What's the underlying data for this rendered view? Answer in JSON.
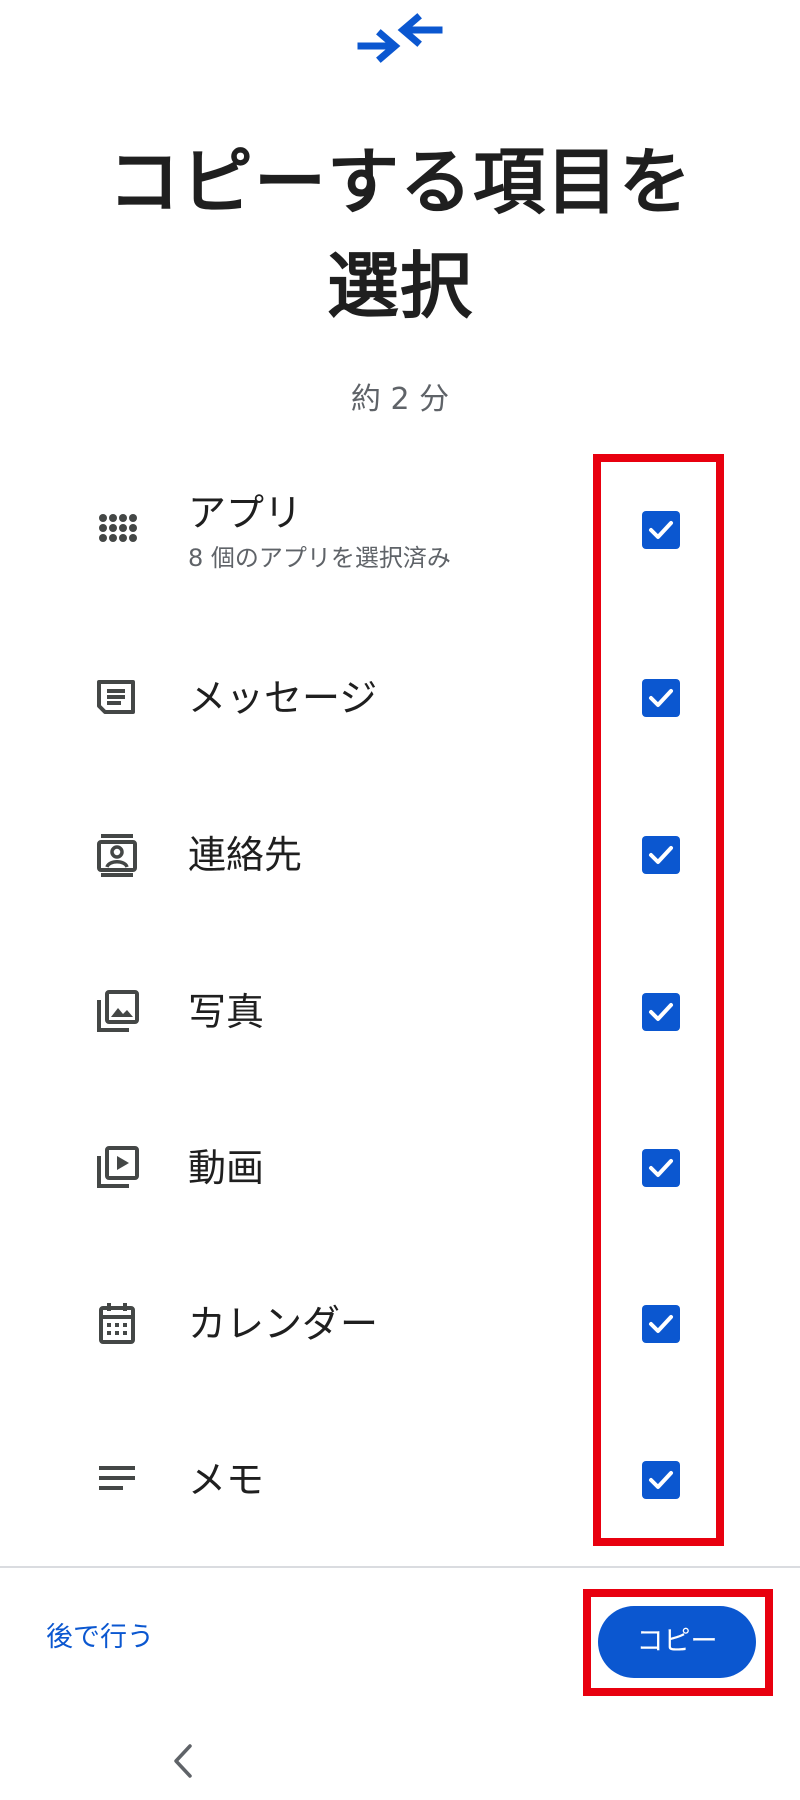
{
  "header": {
    "title_line1": "コピーする項目を",
    "title_line2": "選択",
    "subtitle": "約 2 分"
  },
  "items": [
    {
      "label": "アプリ",
      "sublabel": "8 個のアプリを選択済み",
      "icon": "apps-grid-icon",
      "checked": true
    },
    {
      "label": "メッセージ",
      "icon": "message-icon",
      "checked": true
    },
    {
      "label": "連絡先",
      "icon": "contacts-icon",
      "checked": true
    },
    {
      "label": "写真",
      "icon": "photos-icon",
      "checked": true
    },
    {
      "label": "動画",
      "icon": "video-icon",
      "checked": true
    },
    {
      "label": "カレンダー",
      "icon": "calendar-icon",
      "checked": true
    },
    {
      "label": "メモ",
      "icon": "notes-icon",
      "checked": true
    }
  ],
  "footer": {
    "later_label": "後で行う",
    "copy_label": "コピー"
  },
  "colors": {
    "accent": "#0b57d0",
    "highlight": "#e8000f",
    "text": "#1f1f1f",
    "secondary_text": "#5f6368"
  }
}
